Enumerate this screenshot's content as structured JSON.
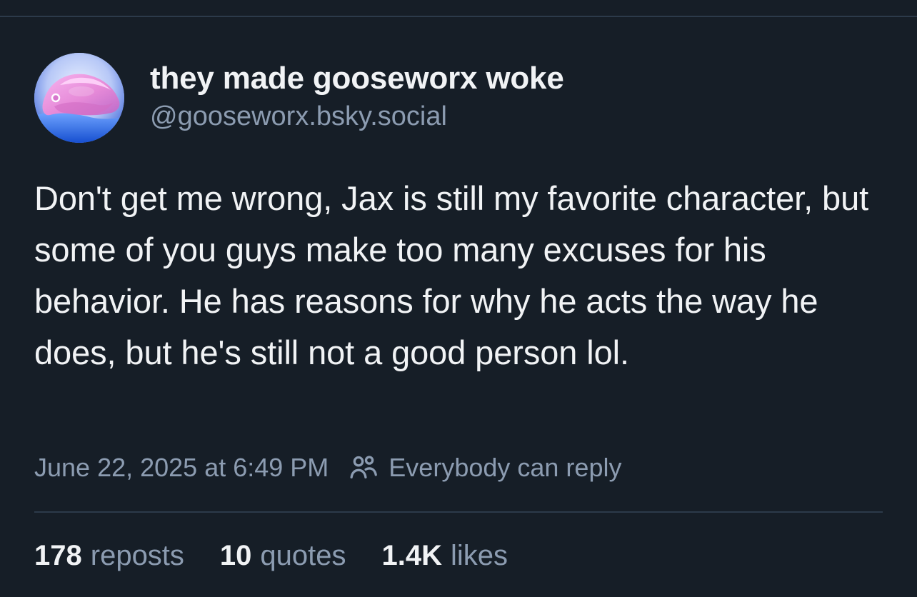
{
  "post": {
    "author": {
      "display_name": "they made gooseworx woke",
      "handle": "@gooseworx.bsky.social",
      "avatar_icon": "pink-creature-avatar"
    },
    "text": "Don't get me wrong, Jax is still my favorite character, but some of you guys make too many excuses for his behavior. He has reasons for why he acts the way he does, but he's still not a good person lol.",
    "timestamp": "June 22, 2025 at 6:49 PM",
    "reply_setting": {
      "icon": "users-icon",
      "label": "Everybody can reply"
    },
    "stats": [
      {
        "count": "178",
        "label": "reposts"
      },
      {
        "count": "10",
        "label": "quotes"
      },
      {
        "count": "1.4K",
        "label": "likes"
      }
    ]
  },
  "colors": {
    "background": "#161e27",
    "primary_text": "#f1f3f5",
    "secondary_text": "#8c9cb1",
    "divider": "#2c3a4a"
  }
}
